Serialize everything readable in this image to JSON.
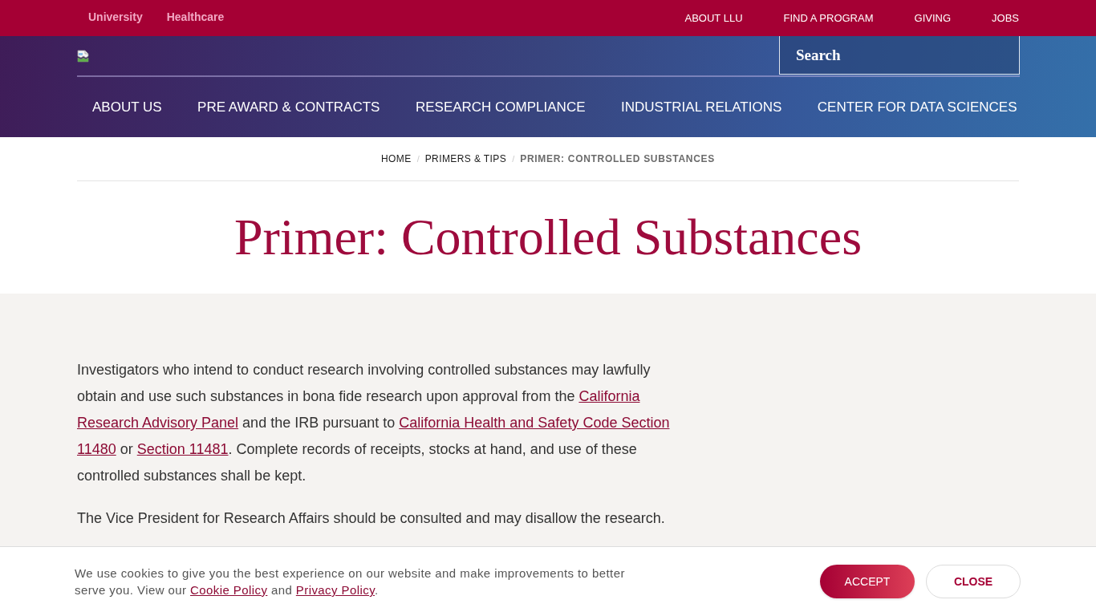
{
  "top_bar": {
    "sites": [
      "University",
      "Healthcare"
    ],
    "links": [
      "ABOUT LLU",
      "FIND A PROGRAM",
      "GIVING",
      "JOBS"
    ]
  },
  "header": {
    "search": {
      "placeholder": "Search"
    },
    "nav": [
      "ABOUT US",
      "PRE AWARD & CONTRACTS",
      "RESEARCH COMPLIANCE",
      "INDUSTRIAL RELATIONS",
      "CENTER FOR DATA SCIENCES"
    ]
  },
  "breadcrumb": {
    "separator": "/",
    "items": [
      {
        "label": "HOME",
        "current": false
      },
      {
        "label": "PRIMERS & TIPS",
        "current": false
      },
      {
        "label": "PRIMER: CONTROLLED SUBSTANCES",
        "current": true
      }
    ]
  },
  "page_title": "Primer: Controlled Substances",
  "content": {
    "paragraphs": [
      [
        {
          "kind": "text",
          "text": "Investigators who intend to conduct research involving controlled substances may lawfully obtain and use such substances in bona fide research upon approval from the "
        },
        {
          "kind": "link",
          "text": "California"
        },
        {
          "kind": "link",
          "text": "Research Advisory Panel"
        },
        {
          "kind": "text",
          "text": " and the IRB pursuant to "
        },
        {
          "kind": "link",
          "text": "California Health and Safety Code Section"
        },
        {
          "kind": "link",
          "text": "11480"
        },
        {
          "kind": "text",
          "text": " or "
        },
        {
          "kind": "link",
          "text": "Section 11481"
        },
        {
          "kind": "text",
          "text": ". Complete records of receipts, stocks at hand, and use of these controlled substances shall be kept."
        }
      ],
      [
        {
          "kind": "text",
          "text": "The Vice President for Research Affairs should be consulted and may disallow the research."
        }
      ]
    ]
  },
  "cookie_banner": {
    "message": [
      {
        "kind": "text",
        "text": "We use cookies to give you the best experience on our website and make improvements to better serve you. View our "
      },
      {
        "kind": "link",
        "text": "Cookie Policy"
      },
      {
        "kind": "text",
        "text": " and "
      },
      {
        "kind": "link",
        "text": "Privacy Policy"
      },
      {
        "kind": "text",
        "text": "."
      }
    ],
    "buttons": [
      {
        "label": "ACCEPT",
        "kind": "primary"
      },
      {
        "label": "CLOSE",
        "kind": "secondary"
      }
    ]
  }
}
